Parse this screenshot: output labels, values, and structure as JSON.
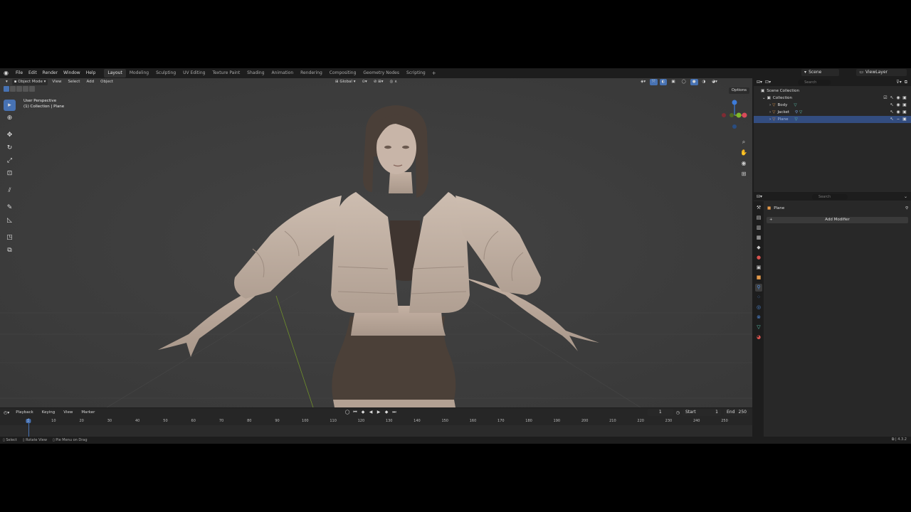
{
  "topbar": {
    "menus": [
      "File",
      "Edit",
      "Render",
      "Window",
      "Help"
    ],
    "workspaces": [
      "Layout",
      "Modeling",
      "Sculpting",
      "UV Editing",
      "Texture Paint",
      "Shading",
      "Animation",
      "Rendering",
      "Compositing",
      "Geometry Nodes",
      "Scripting"
    ],
    "active_workspace": "Layout",
    "add_tab": "+",
    "scene": "Scene",
    "view_layer": "ViewLayer"
  },
  "viewport": {
    "mode": "Object Mode",
    "menus": [
      "View",
      "Select",
      "Add",
      "Object"
    ],
    "orientation": "Global",
    "options": "Options",
    "overlay_line1": "User Perspective",
    "overlay_line2": "(1) Collection | Plane",
    "gizmo_x": "X",
    "gizmo_y": "Y",
    "gizmo_z": "Z"
  },
  "outliner": {
    "search_placeholder": "Search",
    "rows": [
      {
        "label": "Scene Collection",
        "indent": 0
      },
      {
        "label": "Collection",
        "indent": 1
      },
      {
        "label": "Body",
        "indent": 2
      },
      {
        "label": "Jacket",
        "indent": 2
      },
      {
        "label": "Plane",
        "indent": 2,
        "selected": true
      }
    ]
  },
  "properties": {
    "search_placeholder": "Search",
    "object_name": "Plane",
    "add_modifier": "Add Modifier"
  },
  "timeline": {
    "menus": [
      "Playback",
      "Keying",
      "View",
      "Marker"
    ],
    "current_frame": "1",
    "start_label": "Start",
    "start_value": "1",
    "end_label": "End",
    "end_value": "250",
    "ticks": [
      "1",
      "10",
      "20",
      "30",
      "40",
      "50",
      "60",
      "70",
      "80",
      "90",
      "100",
      "110",
      "120",
      "130",
      "140",
      "150",
      "160",
      "170",
      "180",
      "190",
      "200",
      "210",
      "220",
      "230",
      "240",
      "250"
    ]
  },
  "statusbar": {
    "items": [
      "Select",
      "Rotate View",
      "Pie Menu on Drag"
    ],
    "version": "4.3.2"
  },
  "colors": {
    "accent": "#4772b3",
    "viewport_bg": "#3d3d3d",
    "selected_row": "#334d80"
  }
}
